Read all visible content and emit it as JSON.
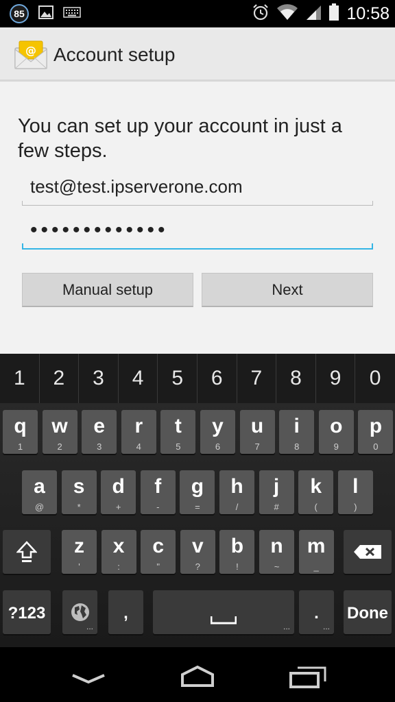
{
  "status_bar": {
    "notification_badge": "85",
    "time": "10:58",
    "icons": [
      "notification-85-icon",
      "image-icon",
      "keyboard-icon",
      "alarm-icon",
      "wifi-icon",
      "signal-icon",
      "battery-icon"
    ]
  },
  "action_bar": {
    "title": "Account setup",
    "icon": "email-envelope-icon"
  },
  "content": {
    "intro": "You can set up your account in just a few steps.",
    "email_value": "test@test.ipserverone.com",
    "password_value": "•••••••••••••",
    "manual_setup_label": "Manual setup",
    "next_label": "Next"
  },
  "keyboard": {
    "number_row": [
      "1",
      "2",
      "3",
      "4",
      "5",
      "6",
      "7",
      "8",
      "9",
      "0"
    ],
    "row1": [
      {
        "k": "q",
        "s": "1"
      },
      {
        "k": "w",
        "s": "2"
      },
      {
        "k": "e",
        "s": "3"
      },
      {
        "k": "r",
        "s": "4"
      },
      {
        "k": "t",
        "s": "5"
      },
      {
        "k": "y",
        "s": "6"
      },
      {
        "k": "u",
        "s": "7"
      },
      {
        "k": "i",
        "s": "8"
      },
      {
        "k": "o",
        "s": "9"
      },
      {
        "k": "p",
        "s": "0"
      }
    ],
    "row2": [
      {
        "k": "a",
        "s": "@"
      },
      {
        "k": "s",
        "s": "*"
      },
      {
        "k": "d",
        "s": "+"
      },
      {
        "k": "f",
        "s": "-"
      },
      {
        "k": "g",
        "s": "="
      },
      {
        "k": "h",
        "s": "/"
      },
      {
        "k": "j",
        "s": "#"
      },
      {
        "k": "k",
        "s": "("
      },
      {
        "k": "l",
        "s": ")"
      }
    ],
    "row3": [
      {
        "k": "z",
        "s": "'"
      },
      {
        "k": "x",
        "s": ":"
      },
      {
        "k": "c",
        "s": "\""
      },
      {
        "k": "v",
        "s": "?"
      },
      {
        "k": "b",
        "s": "!"
      },
      {
        "k": "n",
        "s": "~"
      },
      {
        "k": "m",
        "s": "_"
      }
    ],
    "symbols_label": "?123",
    "comma_label": ",",
    "period_label": ".",
    "done_label": "Done"
  },
  "colors": {
    "accent": "#33b5e5",
    "keyboard_bg": "#1a1a1a",
    "key_bg": "#565656"
  }
}
